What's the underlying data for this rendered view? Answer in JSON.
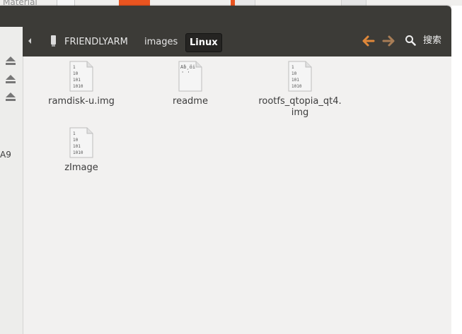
{
  "background_window": {
    "title_fragment": "Material"
  },
  "sidebar": {
    "eject_icons": [
      "eject-icon",
      "eject-icon",
      "eject-icon"
    ],
    "partial_label": "A9"
  },
  "toolbar": {
    "breadcrumbs": [
      {
        "label": "FRIENDLYARM"
      },
      {
        "label": "images"
      },
      {
        "label": "Linux",
        "active": true
      }
    ],
    "search_label": "搜索"
  },
  "files": [
    {
      "name": "ramdisk-u.img",
      "icon": "binary-file-icon",
      "glyph": [
        "1",
        "10",
        "101",
        "1010"
      ]
    },
    {
      "name": "readme",
      "icon": "text-file-icon",
      "glyph": [
        "Aḃ¸öi",
        "' '"
      ]
    },
    {
      "name": "rootfs_qtopia_qt4.\nimg",
      "icon": "binary-file-icon",
      "glyph": [
        "1",
        "10",
        "101",
        "1010"
      ]
    },
    {
      "name": "zImage",
      "icon": "binary-file-icon",
      "glyph": [
        "1",
        "10",
        "101",
        "1010"
      ]
    }
  ],
  "colors": {
    "accent": "#e95420",
    "toolbar": "#3c3b37",
    "content_bg": "#f2f1f0"
  }
}
